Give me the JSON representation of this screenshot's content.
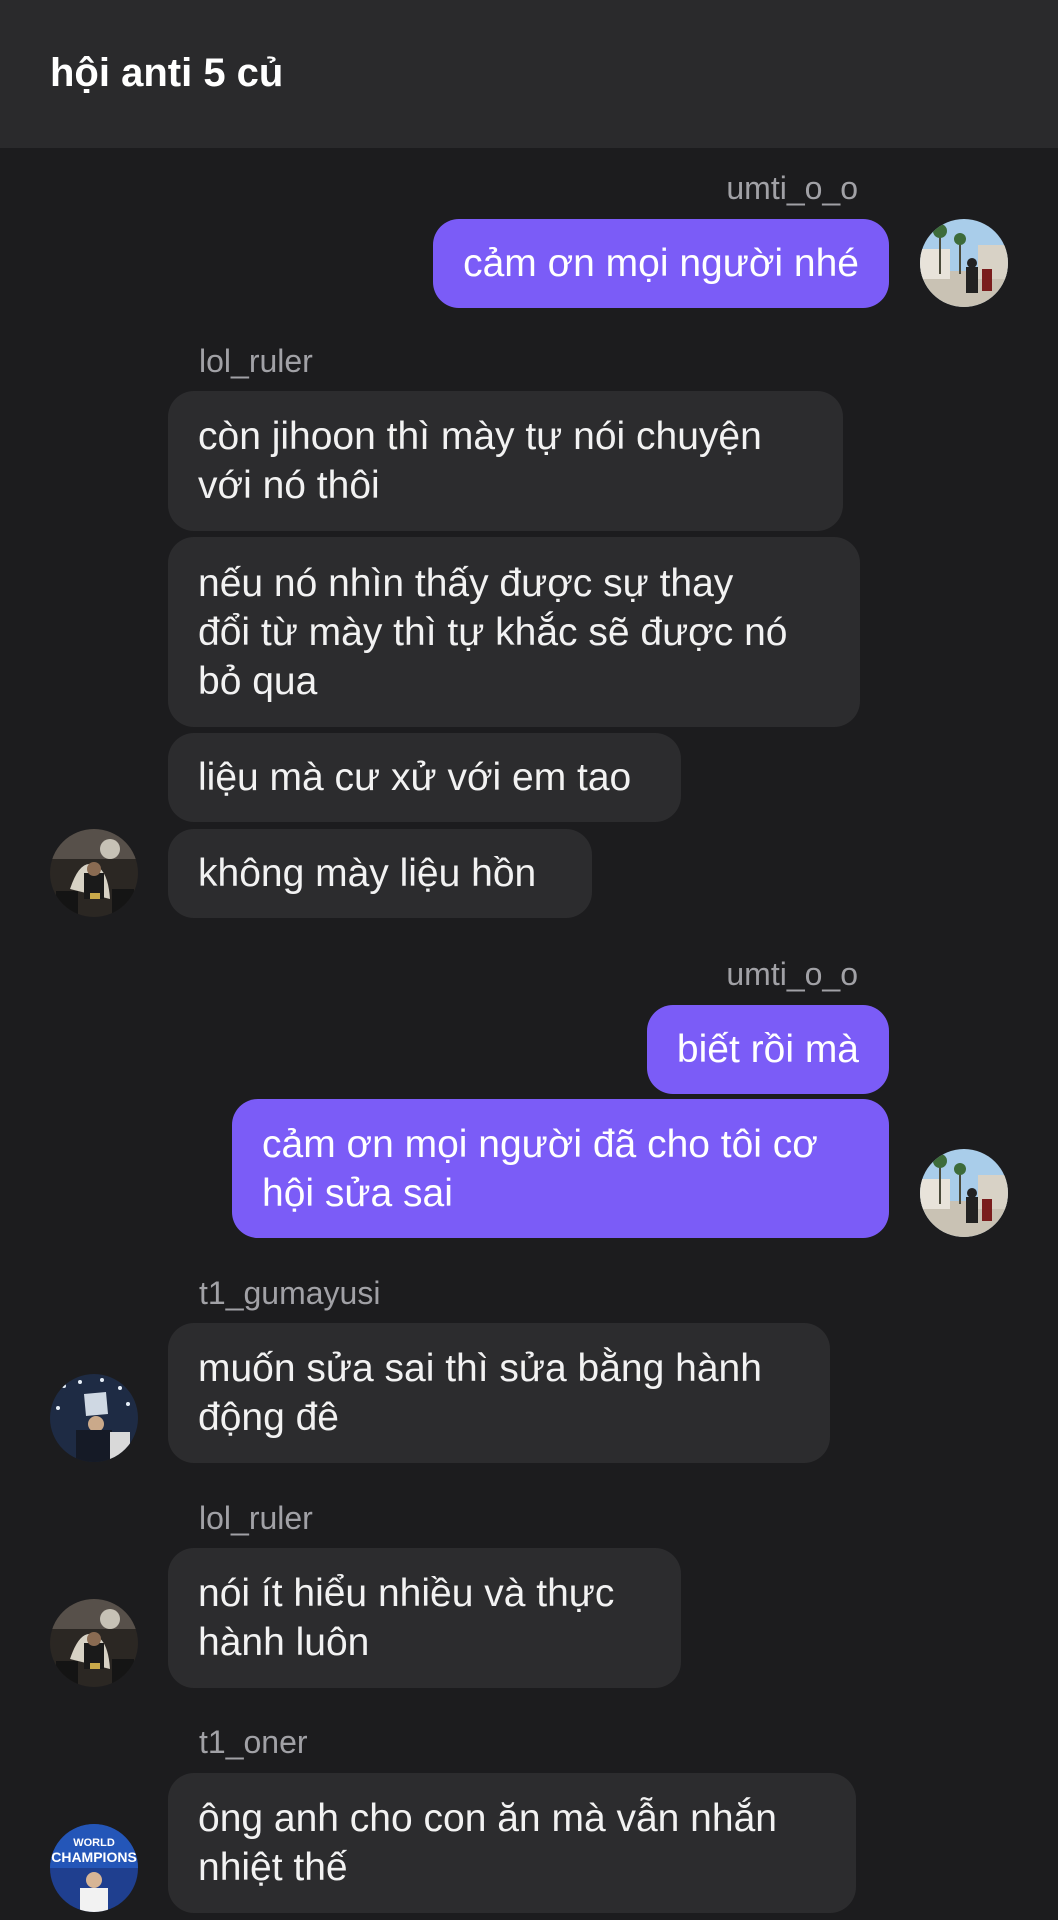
{
  "header": {
    "title": "hội anti 5 củ"
  },
  "messages": [
    {
      "sender": "umti_o_o"
    },
    {
      "text": "cảm ơn mọi người nhé"
    },
    {
      "sender": "lol_ruler"
    },
    {
      "text": "còn jihoon thì mày tự nói chuyện\nvới nó thôi"
    },
    {
      "text": "nếu nó nhìn thấy được sự thay\nđổi từ mày thì tự khắc sẽ được nó\nbỏ qua"
    },
    {
      "text": "liệu mà cư xử với em tao"
    },
    {
      "text": "không mày liệu hồn"
    },
    {
      "sender": "umti_o_o"
    },
    {
      "text": "biết rồi mà"
    },
    {
      "text": "cảm ơn mọi người đã cho tôi cơ\nhội sửa sai"
    },
    {
      "sender": "t1_gumayusi"
    },
    {
      "text": "muốn sửa sai thì sửa bằng hành\nđộng đê"
    },
    {
      "sender": "lol_ruler"
    },
    {
      "text": "nói ít hiểu nhiều và thực\nhành luôn"
    },
    {
      "sender": "t1_oner"
    },
    {
      "text": "ông anh cho con ăn mà vẫn nhắn\nnhiệt thế"
    }
  ],
  "avatars": {
    "umti_o_o": {
      "icon": "profile-photo-street",
      "bg": "#9cc3e6"
    },
    "lol_ruler": {
      "icon": "profile-photo-trophy",
      "bg": "#2e2a26"
    },
    "t1_gumayusi": {
      "icon": "profile-photo-confetti",
      "bg": "#1e2b44"
    },
    "t1_oner": {
      "icon": "profile-photo-world-champions",
      "bg": "#1f3f8f",
      "caption": "WORLD CHAMPIONS"
    }
  },
  "colors": {
    "background": "#1c1c1e",
    "header": "#2a2a2c",
    "outgoing_bubble": "#7b5cf7",
    "incoming_bubble": "#2c2c2e",
    "sender_name": "#a1a1a6"
  }
}
